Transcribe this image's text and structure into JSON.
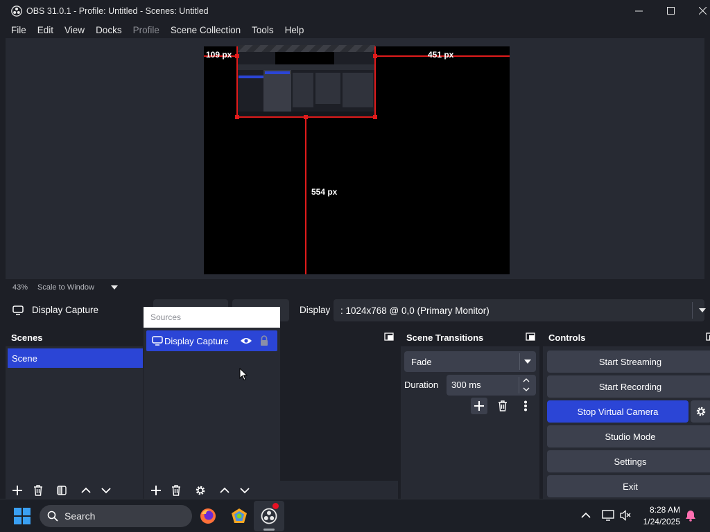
{
  "window": {
    "title": "OBS 31.0.1 - Profile: Untitled - Scenes: Untitled"
  },
  "menu": [
    "File",
    "Edit",
    "View",
    "Docks",
    "Profile",
    "Scene Collection",
    "Tools",
    "Help"
  ],
  "preview": {
    "measure_left": "109 px",
    "measure_right": "451 px",
    "measure_bottom": "554 px",
    "zoom": "43%",
    "scale_mode": "Scale to Window"
  },
  "source_toolbar": {
    "source_name": "Display Capture",
    "display_label": "Display",
    "display_value": ": 1024x768 @ 0,0 (Primary Monitor)"
  },
  "scenes": {
    "title": "Scenes",
    "items": [
      "Scene"
    ]
  },
  "sources": {
    "title": "Sources",
    "items": [
      "Display Capture"
    ]
  },
  "transitions": {
    "title": "Scene Transitions",
    "selected": "Fade",
    "duration_label": "Duration",
    "duration_value": "300 ms"
  },
  "controls": {
    "title": "Controls",
    "start_streaming": "Start Streaming",
    "start_recording": "Start Recording",
    "stop_virtual_camera": "Stop Virtual Camera",
    "studio_mode": "Studio Mode",
    "settings": "Settings",
    "exit": "Exit"
  },
  "taskbar": {
    "search_label": "Search",
    "time": "8:28 AM",
    "date": "1/24/2025"
  },
  "colors": {
    "accent": "#2b45d6",
    "measure": "#e01b1b",
    "dock_bg": "#272a33",
    "window_bg": "#1d1f26"
  }
}
